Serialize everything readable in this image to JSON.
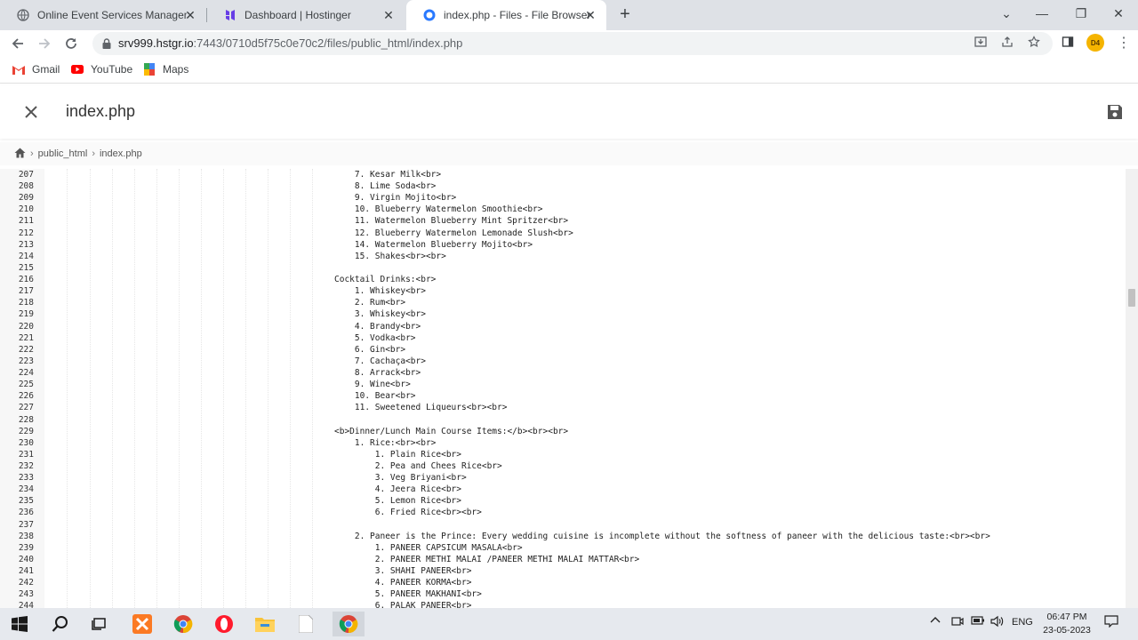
{
  "browser": {
    "tabs": [
      {
        "title": "Online Event Services Manageme",
        "close": "✕"
      },
      {
        "title": "Dashboard | Hostinger",
        "close": "✕"
      },
      {
        "title": "index.php - Files - File Browser",
        "close": "✕"
      }
    ],
    "new_tab": "+",
    "url_host": "srv999.hstgr.io",
    "url_path": ":7443/0710d5f75c0e70c2/files/public_html/index.php",
    "profile_initials": "D4",
    "bookmarks": [
      "Gmail",
      "YouTube",
      "Maps"
    ]
  },
  "app": {
    "title": "index.php",
    "breadcrumb": [
      "public_html",
      "index.php"
    ]
  },
  "editor": {
    "lines": [
      {
        "n": "207",
        "text": "    7. Kesar Milk<br>"
      },
      {
        "n": "208",
        "text": "    8. Lime Soda<br>"
      },
      {
        "n": "209",
        "text": "    9. Virgin Mojito<br>"
      },
      {
        "n": "210",
        "text": "    10. Blueberry Watermelon Smoothie<br>"
      },
      {
        "n": "211",
        "text": "    11. Watermelon Blueberry Mint Spritzer<br>"
      },
      {
        "n": "212",
        "text": "    12. Blueberry Watermelon Lemonade Slush<br>"
      },
      {
        "n": "213",
        "text": "    14. Watermelon Blueberry Mojito<br>"
      },
      {
        "n": "214",
        "text": "    15. Shakes<br><br>"
      },
      {
        "n": "215",
        "text": ""
      },
      {
        "n": "216",
        "text": "Cocktail Drinks:<br>"
      },
      {
        "n": "217",
        "text": "    1. Whiskey<br>"
      },
      {
        "n": "218",
        "text": "    2. Rum<br>"
      },
      {
        "n": "219",
        "text": "    3. Whiskey<br>"
      },
      {
        "n": "220",
        "text": "    4. Brandy<br>"
      },
      {
        "n": "221",
        "text": "    5. Vodka<br>"
      },
      {
        "n": "222",
        "text": "    6. Gin<br>"
      },
      {
        "n": "223",
        "text": "    7. Cachaça<br>"
      },
      {
        "n": "224",
        "text": "    8. Arrack<br>"
      },
      {
        "n": "225",
        "text": "    9. Wine<br>"
      },
      {
        "n": "226",
        "text": "    10. Bear<br>"
      },
      {
        "n": "227",
        "text": "    11. Sweetened Liqueurs<br><br>"
      },
      {
        "n": "228",
        "text": ""
      },
      {
        "n": "229",
        "text": "<b>Dinner/Lunch Main Course Items:</b><br><br>"
      },
      {
        "n": "230",
        "text": "    1. Rice:<br><br>"
      },
      {
        "n": "231",
        "text": "        1. Plain Rice<br>"
      },
      {
        "n": "232",
        "text": "        2. Pea and Chees Rice<br>"
      },
      {
        "n": "233",
        "text": "        3. Veg Briyani<br>"
      },
      {
        "n": "234",
        "text": "        4. Jeera Rice<br>"
      },
      {
        "n": "235",
        "text": "        5. Lemon Rice<br>"
      },
      {
        "n": "236",
        "text": "        6. Fried Rice<br><br>"
      },
      {
        "n": "237",
        "text": ""
      },
      {
        "n": "238",
        "text": "    2. Paneer is the Prince: Every wedding cuisine is incomplete without the softness of paneer with the delicious taste:<br><br>"
      },
      {
        "n": "239",
        "text": "        1. PANEER CAPSICUM MASALA<br>"
      },
      {
        "n": "240",
        "text": "        2. PANEER METHI MALAI /PANEER METHI MALAI MATTAR<br>"
      },
      {
        "n": "241",
        "text": "        3. SHAHI PANEER<br>"
      },
      {
        "n": "242",
        "text": "        4. PANEER KORMA<br>"
      },
      {
        "n": "243",
        "text": "        5. PANEER MAKHANI<br>"
      },
      {
        "n": "244",
        "text": "        6. PALAK PANEER<br>"
      }
    ]
  },
  "taskbar": {
    "lang": "ENG",
    "time": "06:47 PM",
    "date": "23-05-2023"
  }
}
